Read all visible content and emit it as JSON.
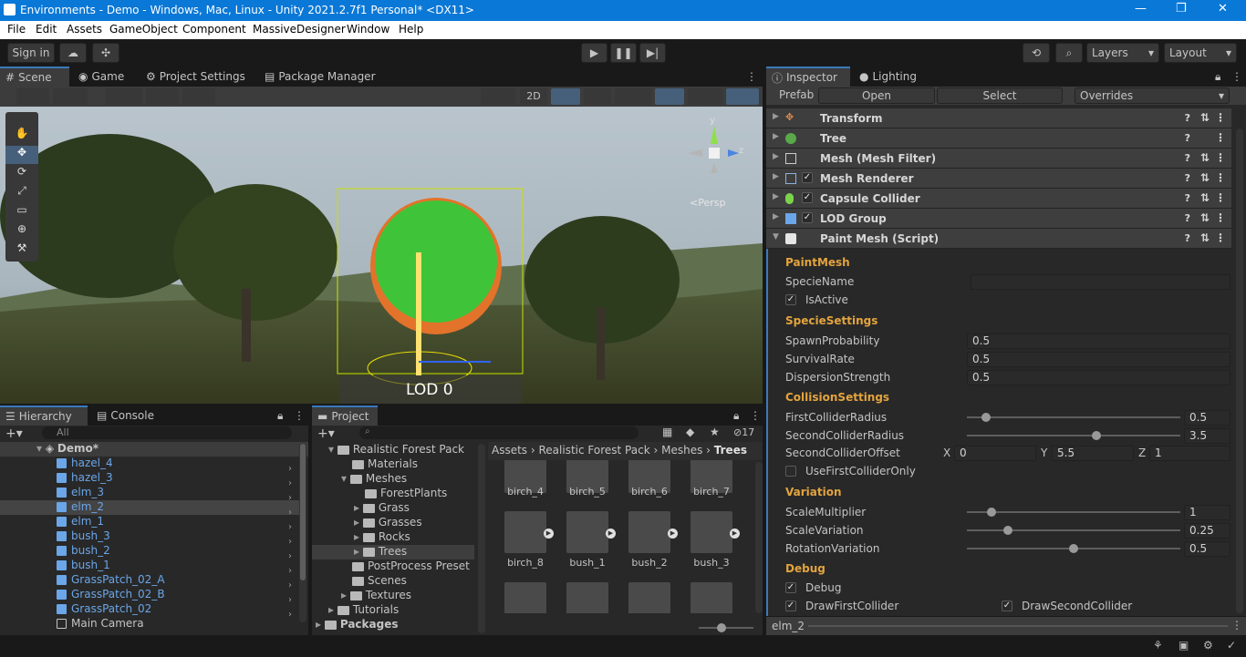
{
  "window": {
    "title": "Environments - Demo - Windows, Mac, Linux - Unity 2021.2.7f1 Personal* <DX11>",
    "minimize": "—",
    "maximize": "❐",
    "close": "✕"
  },
  "menu": [
    "File",
    "Edit",
    "Assets",
    "GameObject",
    "Component",
    "MassiveDesigner",
    "Window",
    "Help"
  ],
  "toolbar": {
    "sign_in": "Sign in",
    "layers": "Layers",
    "layout": "Layout"
  },
  "scene_tabs": {
    "scene": "Scene",
    "game": "Game",
    "project_settings": "Project Settings",
    "package_manager": "Package Manager"
  },
  "scene_toolbar": {
    "mode_2d": "2D"
  },
  "viewport": {
    "persp": "<Persp",
    "lod_label": "LOD 0",
    "gizmo_y": "y",
    "gizmo_z": "z"
  },
  "hierarchy": {
    "tab": "Hierarchy",
    "console_tab": "Console",
    "search_placeholder": "All",
    "scene": "Demo*",
    "items": [
      "hazel_4",
      "hazel_3",
      "elm_3",
      "elm_2",
      "elm_1",
      "bush_3",
      "bush_2",
      "bush_1",
      "GrassPatch_02_A",
      "GrassPatch_02_B",
      "GrassPatch_02",
      "Main Camera"
    ]
  },
  "project": {
    "tab": "Project",
    "count": "17",
    "tree": [
      {
        "label": "Realistic Forest Pack"
      },
      {
        "label": "Materials"
      },
      {
        "label": "Meshes"
      },
      {
        "label": "ForestPlants"
      },
      {
        "label": "Grass"
      },
      {
        "label": "Grasses"
      },
      {
        "label": "Rocks"
      },
      {
        "label": "Trees"
      },
      {
        "label": "PostProcess Preset"
      },
      {
        "label": "Scenes"
      },
      {
        "label": "Textures"
      },
      {
        "label": "Tutorials"
      },
      {
        "label": "Packages"
      }
    ],
    "breadcrumb": [
      "Assets",
      "Realistic Forest Pack",
      "Meshes",
      "Trees"
    ],
    "assets_row1": [
      "birch_4",
      "birch_5",
      "birch_6",
      "birch_7"
    ],
    "assets_row2": [
      "birch_8",
      "bush_1",
      "bush_2",
      "bush_3"
    ]
  },
  "inspector": {
    "tab": "Inspector",
    "lighting_tab": "Lighting",
    "prefab": "Prefab",
    "open": "Open",
    "select": "Select",
    "overrides": "Overrides",
    "components": [
      "Transform",
      "Tree",
      "Mesh (Mesh Filter)",
      "Mesh Renderer",
      "Capsule Collider",
      "LOD Group",
      "Paint Mesh (Script)"
    ],
    "paint": {
      "h_paintmesh": "PaintMesh",
      "specie_name": "SpecieName",
      "is_active": "IsActive",
      "h_specie": "SpecieSettings",
      "spawn_prob": "SpawnProbability",
      "spawn_prob_v": "0.5",
      "survival": "SurvivalRate",
      "survival_v": "0.5",
      "dispersion": "DispersionStrength",
      "dispersion_v": "0.5",
      "h_collision": "CollisionSettings",
      "first_r": "FirstColliderRadius",
      "first_r_v": "0.5",
      "second_r": "SecondColliderRadius",
      "second_r_v": "3.5",
      "second_off": "SecondColliderOffset",
      "x": "X",
      "x_v": "0",
      "y": "Y",
      "y_v": "5.5",
      "z": "Z",
      "z_v": "1",
      "use_first": "UseFirstColliderOnly",
      "h_variation": "Variation",
      "scale_mult": "ScaleMultiplier",
      "scale_mult_v": "1",
      "scale_var": "ScaleVariation",
      "scale_var_v": "0.25",
      "rot_var": "RotationVariation",
      "rot_var_v": "0.5",
      "h_debug": "Debug",
      "debug": "Debug",
      "draw_first": "DrawFirstCollider",
      "draw_second": "DrawSecondCollider"
    },
    "preview": "elm_2"
  },
  "colors": {
    "accent": "#0a78d7",
    "header": "#e3a43e",
    "selection": "#2c5d87"
  },
  "sliders": {
    "first_r": 0.07,
    "second_r": 0.61,
    "scale_mult": 0.1,
    "scale_var": 0.18,
    "rot_var": 0.5
  }
}
